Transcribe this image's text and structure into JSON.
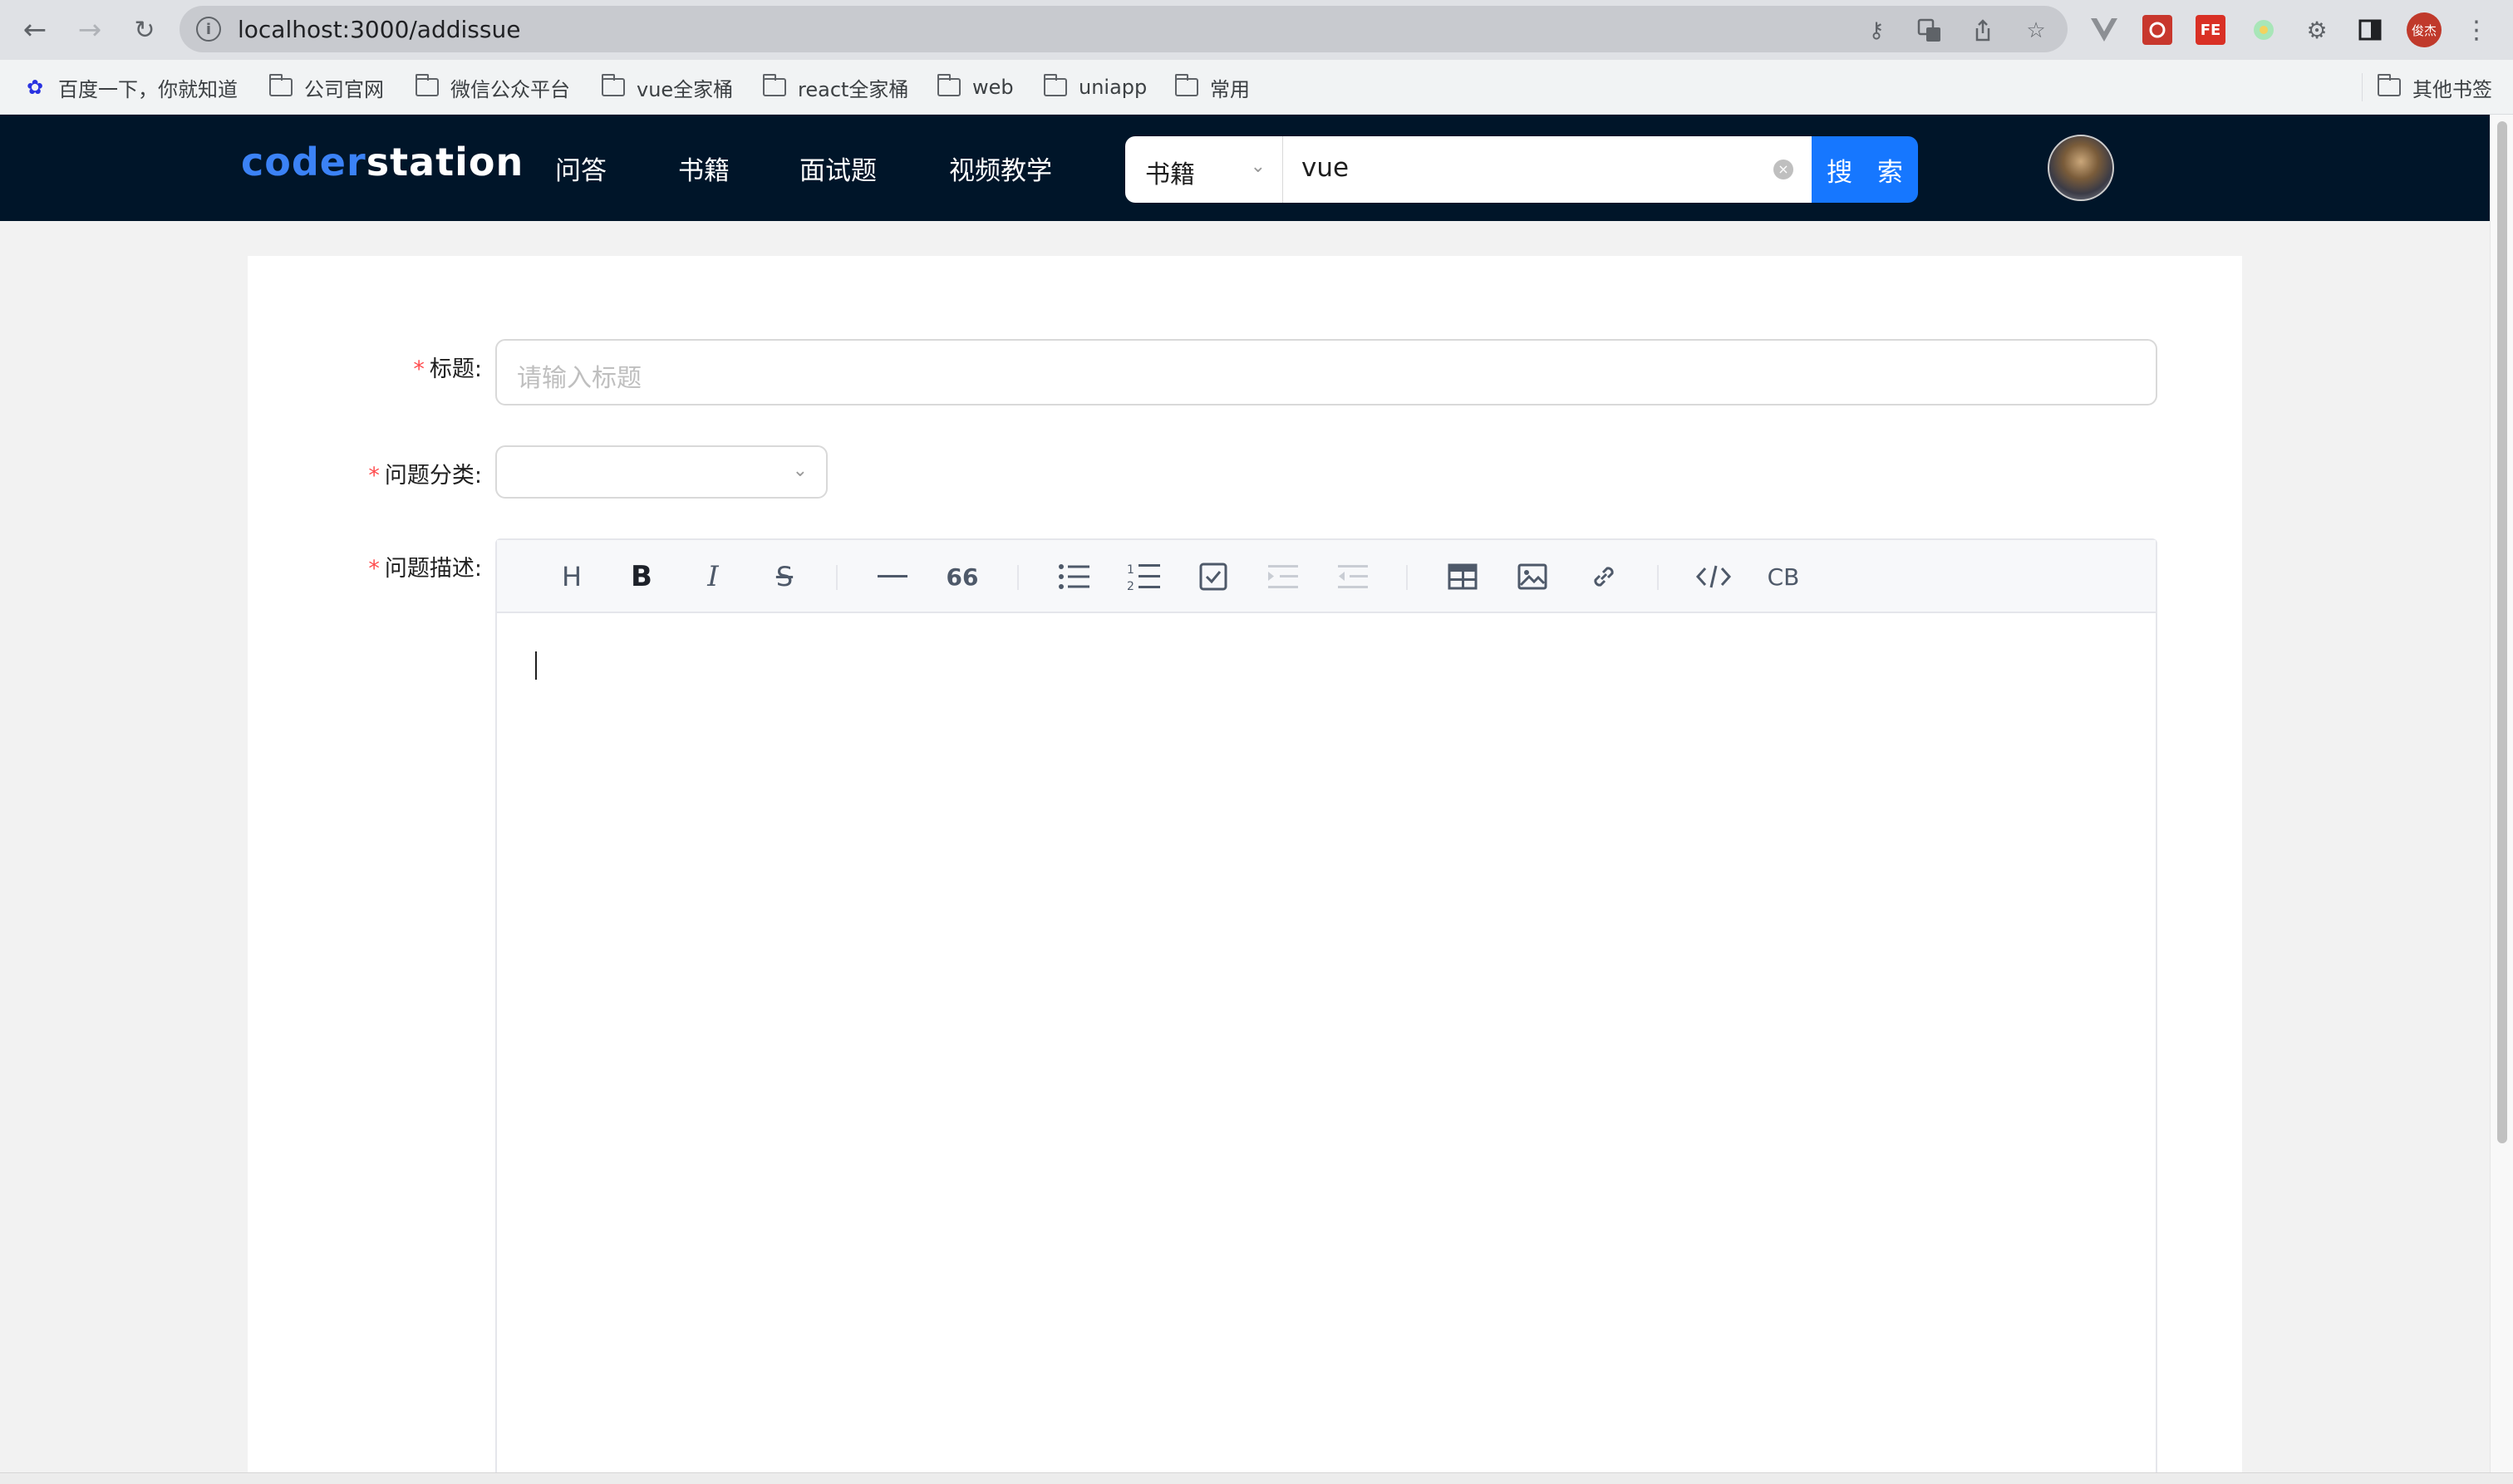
{
  "browser": {
    "url": "localhost:3000/addissue",
    "profile_badge": "俊杰",
    "extension_label_fe": "FE"
  },
  "bookmarks": {
    "items": [
      {
        "label": "百度一下，你就知道",
        "icon": "baidu-paw-icon"
      },
      {
        "label": "公司官网",
        "icon": "folder-icon"
      },
      {
        "label": "微信公众平台",
        "icon": "folder-icon"
      },
      {
        "label": "vue全家桶",
        "icon": "folder-icon"
      },
      {
        "label": "react全家桶",
        "icon": "folder-icon"
      },
      {
        "label": "web",
        "icon": "folder-icon"
      },
      {
        "label": "uniapp",
        "icon": "folder-icon"
      },
      {
        "label": "常用",
        "icon": "folder-icon"
      }
    ],
    "other": "其他书签"
  },
  "header": {
    "logo_part1": "coder",
    "logo_part2": "station",
    "menu": [
      "问答",
      "书籍",
      "面试题",
      "视频教学"
    ],
    "search": {
      "type_selected": "书籍",
      "query": "vue",
      "button": "搜 索"
    }
  },
  "form": {
    "title_label": "标题",
    "title_placeholder": "请输入标题",
    "category_label": "问题分类",
    "category_value": "",
    "description_label": "问题描述",
    "required_mark": "*",
    "label_suffix": ":"
  },
  "editor": {
    "toolbar_groups": [
      [
        "heading",
        "bold",
        "italic",
        "strikethrough"
      ],
      [
        "horizontal-rule",
        "quote"
      ],
      [
        "unordered-list",
        "ordered-list",
        "task-list",
        "indent",
        "outdent"
      ],
      [
        "table",
        "image",
        "link"
      ],
      [
        "code",
        "code-block"
      ]
    ],
    "code_block_label": "CB",
    "content": ""
  },
  "colors": {
    "header_bg": "#001529",
    "accent": "#1677ff",
    "logo_accent": "#3b82f6",
    "required": "#ff4d4f"
  }
}
